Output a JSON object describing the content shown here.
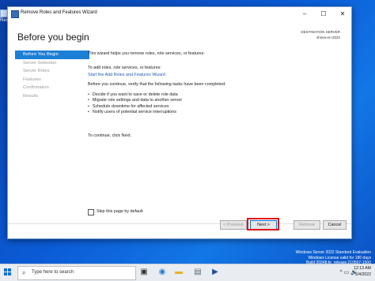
{
  "desktop": {
    "icon_label": "Rec"
  },
  "window": {
    "title": "Remove Roles and Features Wizard",
    "controls": {
      "min": "–",
      "max": "☐",
      "close": "✕"
    }
  },
  "header": {
    "page_title": "Before you begin",
    "dest_label": "DESTINATION SERVER",
    "dest_value": "shima-en-2022"
  },
  "nav": {
    "items": [
      {
        "label": "Before You Begin",
        "active": true
      },
      {
        "label": "Server Selection",
        "active": false
      },
      {
        "label": "Server Roles",
        "active": false
      },
      {
        "label": "Features",
        "active": false
      },
      {
        "label": "Confirmation",
        "active": false
      },
      {
        "label": "Results",
        "active": false
      }
    ]
  },
  "content": {
    "intro": "This wizard helps you remove roles, role services, or features.",
    "add_title": "To add roles, role services, or features:",
    "add_link": "Start the Add Roles and Features Wizard",
    "verify": "Before you continue, verify that the following tasks have been completed:",
    "bullets": [
      "Decide if you want to save or delete role data",
      "Migrate role settings and data to another server",
      "Schedule downtime for affected services",
      "Notify users of potential service interruptions"
    ],
    "to_continue": "To continue, click Next.",
    "skip_label": "Skip this page by default"
  },
  "buttons": {
    "previous": "< Previous",
    "next": "Next >",
    "remove": "Remove",
    "cancel": "Cancel"
  },
  "taskbar": {
    "search_placeholder": "Type here to search",
    "tray": "^ ▭ 🔊",
    "time": "12:13 AM",
    "date": "5/4/2022"
  },
  "watermark": {
    "line1": "Windows Server 2022 Standard Evaluation",
    "line2": "Windows License valid for 180 days",
    "line3": "Build 20348.fe_release.210507-1500"
  },
  "colors": {
    "accent": "#1c7fd6",
    "highlight": "#e0101a",
    "link": "#1f5fb3"
  }
}
